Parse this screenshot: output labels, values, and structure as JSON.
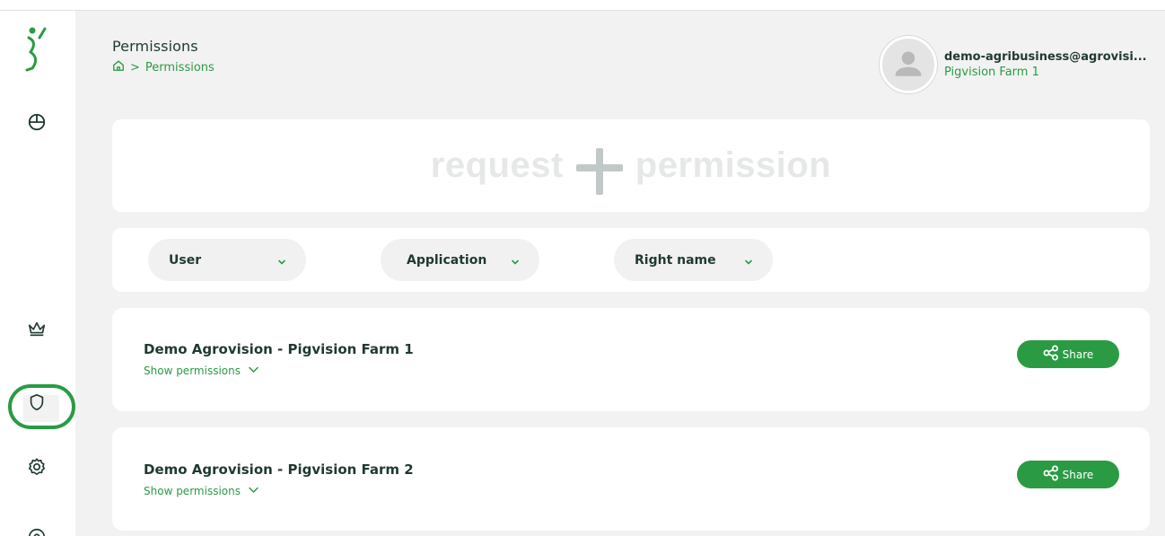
{
  "page": {
    "title": "Permissions",
    "breadcrumb": {
      "current": "Permissions",
      "separator": ">"
    }
  },
  "user": {
    "email": "demo-agribusiness@agrovisi...",
    "farm": "Pigvision Farm 1"
  },
  "sidebar": {
    "items": [
      {
        "name": "logo",
        "icon": "runner-logo-icon"
      },
      {
        "name": "dashboard",
        "icon": "pie-chart-icon"
      },
      {
        "name": "subscription",
        "icon": "crown-icon"
      },
      {
        "name": "permissions",
        "icon": "shield-icon",
        "active": true
      },
      {
        "name": "settings",
        "icon": "gear-icon"
      },
      {
        "name": "help",
        "icon": "help-circle-icon"
      }
    ]
  },
  "request": {
    "left": "request",
    "right": "permission"
  },
  "filters": [
    {
      "label": "User"
    },
    {
      "label": "Application"
    },
    {
      "label": "Right name"
    }
  ],
  "farms": [
    {
      "name": "Demo Agrovision - Pigvision Farm 1",
      "show_label": "Show permissions",
      "share_label": "Share"
    },
    {
      "name": "Demo Agrovision - Pigvision Farm 2",
      "show_label": "Show permissions",
      "share_label": "Share"
    }
  ],
  "colors": {
    "accent": "#2a9b43",
    "text_dark": "#1f3a2e",
    "background": "#f2f2f2",
    "card": "#ffffff"
  }
}
